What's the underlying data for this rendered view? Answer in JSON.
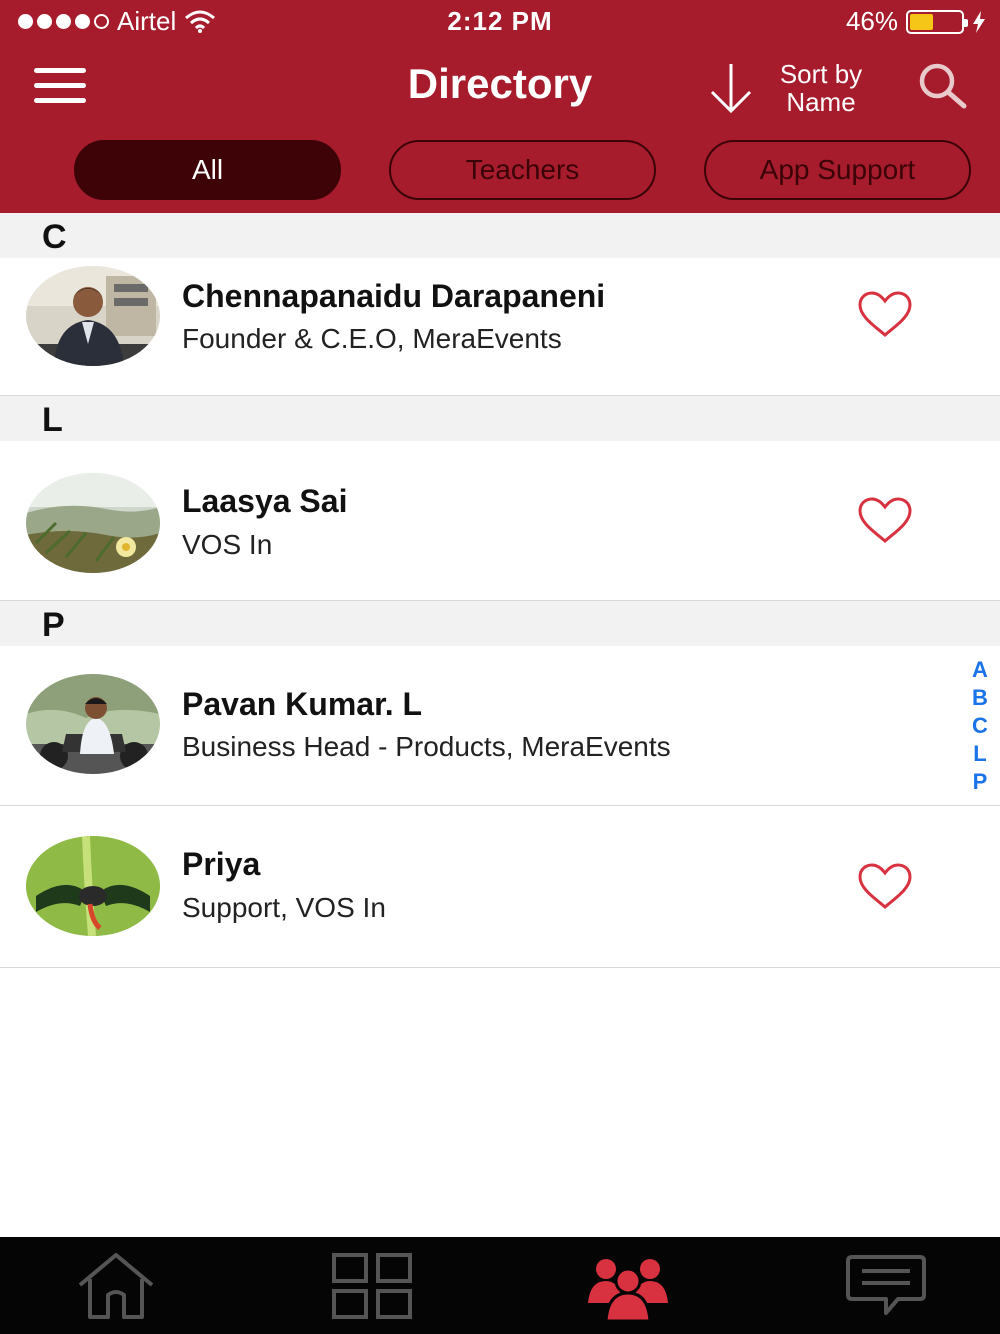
{
  "status_bar": {
    "carrier": "Airtel",
    "time": "2:12 PM",
    "battery": "46%",
    "battery_level": 0.46,
    "signal_dots_filled": 4,
    "signal_dots_total": 5
  },
  "header": {
    "title": "Directory",
    "sort_label_line1": "Sort by",
    "sort_label_line2": "Name",
    "menu_icon": "hamburger-icon",
    "search_icon": "search-icon"
  },
  "filters": [
    {
      "label": "All",
      "active": true
    },
    {
      "label": "Teachers",
      "active": false
    },
    {
      "label": "App Support",
      "active": false
    }
  ],
  "sections": [
    {
      "letter": "C",
      "contacts": [
        {
          "name": "Chennapanaidu Darapaneni",
          "subtitle": "Founder & C.E.O, MeraEvents"
        }
      ]
    },
    {
      "letter": "L",
      "contacts": [
        {
          "name": "Laasya Sai",
          "subtitle": "VOS In"
        }
      ]
    },
    {
      "letter": "P",
      "contacts": [
        {
          "name": "Pavan  Kumar. L",
          "subtitle": "Business Head - Products, MeraEvents"
        },
        {
          "name": "Priya",
          "subtitle": "Support, VOS In"
        }
      ]
    }
  ],
  "index_letters": [
    "A",
    "B",
    "C",
    "L",
    "P"
  ],
  "tabs": [
    {
      "icon": "home-icon",
      "active": false
    },
    {
      "icon": "grid-icon",
      "active": false
    },
    {
      "icon": "people-icon",
      "active": true
    },
    {
      "icon": "chat-icon",
      "active": false
    }
  ],
  "colors": {
    "header_bg": "#a61c2c",
    "pill_active_bg": "#3d0307",
    "heart": "#d8313f",
    "index_letters": "#1a73e8",
    "tab_active": "#d8313f",
    "tab_inactive": "#555555",
    "tabbar_bg": "#050505"
  }
}
